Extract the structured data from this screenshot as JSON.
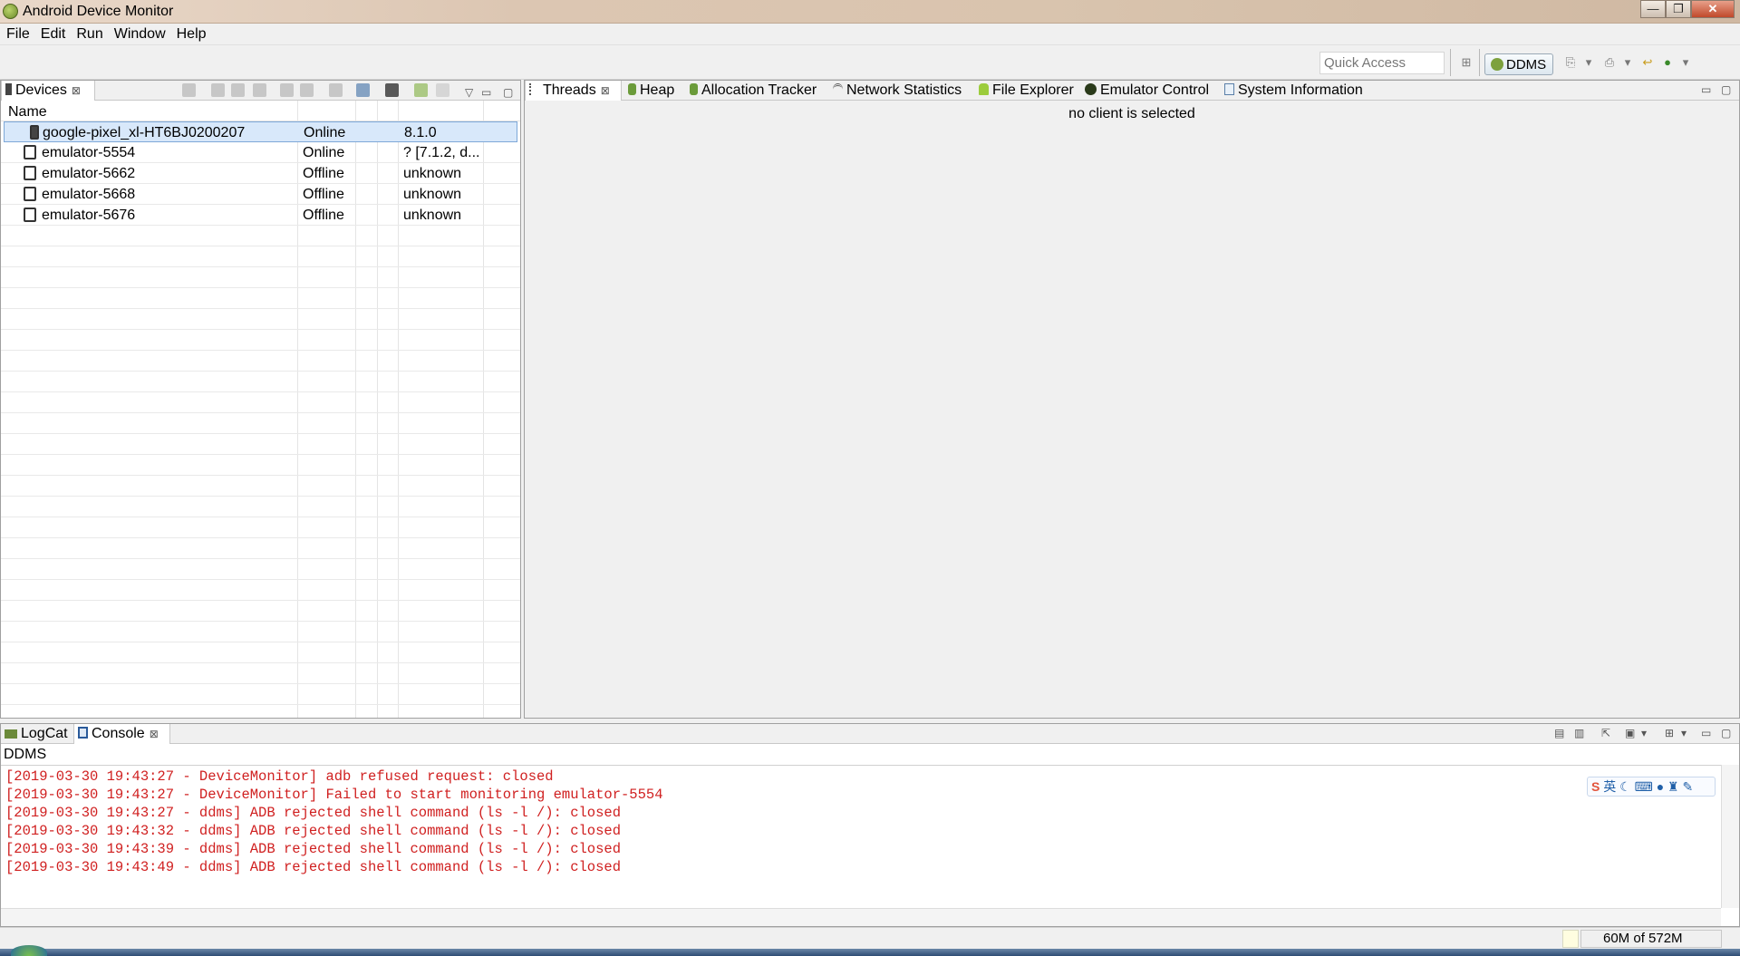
{
  "window": {
    "title": "Android Device Monitor",
    "controls": [
      "—",
      "❐",
      "✕"
    ]
  },
  "menu": [
    "File",
    "Edit",
    "Run",
    "Window",
    "Help"
  ],
  "toolbar": {
    "quick_access_placeholder": "Quick Access",
    "perspective": "DDMS"
  },
  "devices_panel": {
    "tab_label": "Devices",
    "columns": [
      "Name"
    ],
    "rows": [
      {
        "name": "google-pixel_xl-HT6BJ0200207",
        "state": "Online",
        "version": "8.1.0",
        "icon": "phone-icon",
        "selected": true
      },
      {
        "name": "emulator-5554",
        "state": "Online",
        "version": "? [7.1.2, d...",
        "icon": "emulator-icon",
        "selected": false
      },
      {
        "name": "emulator-5662",
        "state": "Offline",
        "version": "unknown",
        "icon": "emulator-icon",
        "selected": false
      },
      {
        "name": "emulator-5668",
        "state": "Offline",
        "version": "unknown",
        "icon": "emulator-icon",
        "selected": false
      },
      {
        "name": "emulator-5676",
        "state": "Offline",
        "version": "unknown",
        "icon": "emulator-icon",
        "selected": false
      }
    ]
  },
  "right_tabs": [
    "Threads",
    "Heap",
    "Allocation Tracker",
    "Network Statistics",
    "File Explorer",
    "Emulator Control",
    "System Information"
  ],
  "threads_message": "no client is selected",
  "bottom_tabs": [
    "LogCat",
    "Console"
  ],
  "console": {
    "label": "DDMS",
    "lines": [
      "[2019-03-30 19:43:27 - DeviceMonitor] adb refused request: closed",
      "[2019-03-30 19:43:27 - DeviceMonitor] Failed to start monitoring emulator-5554",
      "[2019-03-30 19:43:27 - ddms] ADB rejected shell command (ls -l /): closed",
      "[2019-03-30 19:43:32 - ddms] ADB rejected shell command (ls -l /): closed",
      "[2019-03-30 19:43:39 - ddms] ADB rejected shell command (ls -l /): closed",
      "[2019-03-30 19:43:49 - ddms] ADB rejected shell command (ls -l /): closed"
    ],
    "ime_label": "英"
  },
  "status": {
    "heap": "60M of 572M"
  },
  "colors": {
    "log_error": "#d02020",
    "selection": "#d8e8fa"
  }
}
